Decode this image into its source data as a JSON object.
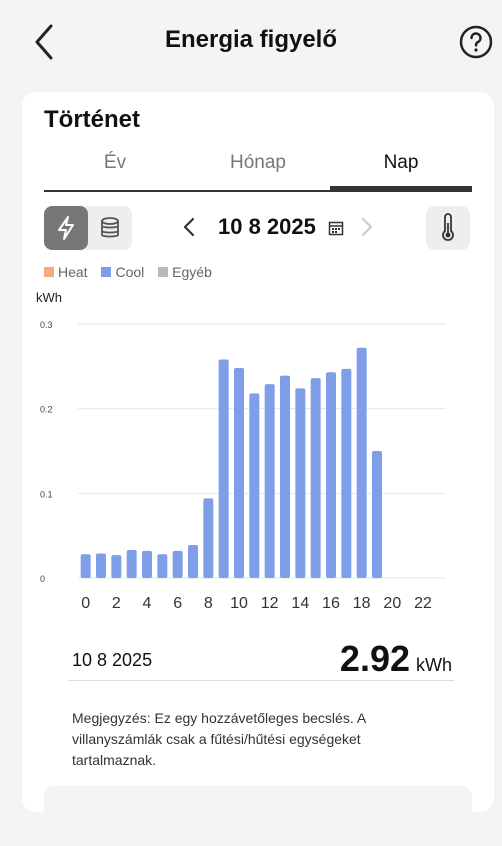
{
  "header": {
    "title": "Energia figyelő"
  },
  "history": {
    "title": "Történet",
    "tabs": [
      {
        "label": "Év",
        "active": false
      },
      {
        "label": "Hónap",
        "active": false
      },
      {
        "label": "Nap",
        "active": true
      }
    ]
  },
  "controls": {
    "date": "10 8 2025",
    "active_toggle": "energy",
    "icons": [
      "lightning-icon",
      "coins-icon",
      "chevron-left-icon",
      "calendar-icon",
      "chevron-right-icon",
      "thermometer-icon"
    ]
  },
  "legend": [
    {
      "label": "Heat",
      "color": "#f5a97f"
    },
    {
      "label": "Cool",
      "color": "#7f9ee8"
    },
    {
      "label": "Egyéb",
      "color": "#b8b8b8"
    }
  ],
  "chart_data": {
    "type": "bar",
    "ylabel": "kWh",
    "ylim": [
      0,
      0.3
    ],
    "yticks": [
      "0.3",
      "0.2",
      "0.1",
      "0"
    ],
    "xtick_labels": [
      "0",
      "2",
      "4",
      "6",
      "8",
      "10",
      "12",
      "14",
      "16",
      "18",
      "20",
      "22"
    ],
    "categories": [
      0,
      1,
      2,
      3,
      4,
      5,
      6,
      7,
      8,
      9,
      10,
      11,
      12,
      13,
      14,
      15,
      16,
      17,
      18,
      19,
      20,
      21,
      22,
      23
    ],
    "series": [
      {
        "name": "Cool",
        "color": "#7f9ee8",
        "values": [
          0.028,
          0.029,
          0.027,
          0.033,
          0.032,
          0.028,
          0.032,
          0.039,
          0.094,
          0.258,
          0.248,
          0.218,
          0.229,
          0.239,
          0.224,
          0.236,
          0.243,
          0.247,
          0.272,
          0.15,
          0,
          0,
          0,
          0
        ]
      }
    ]
  },
  "summary": {
    "date": "10 8 2025",
    "value": "2.92",
    "unit": "kWh"
  },
  "note": "Megjegyzés: Ez egy hozzávetőleges becslés. A villanyszámlák csak a fűtési/hűtési egységeket tartalmaznak."
}
